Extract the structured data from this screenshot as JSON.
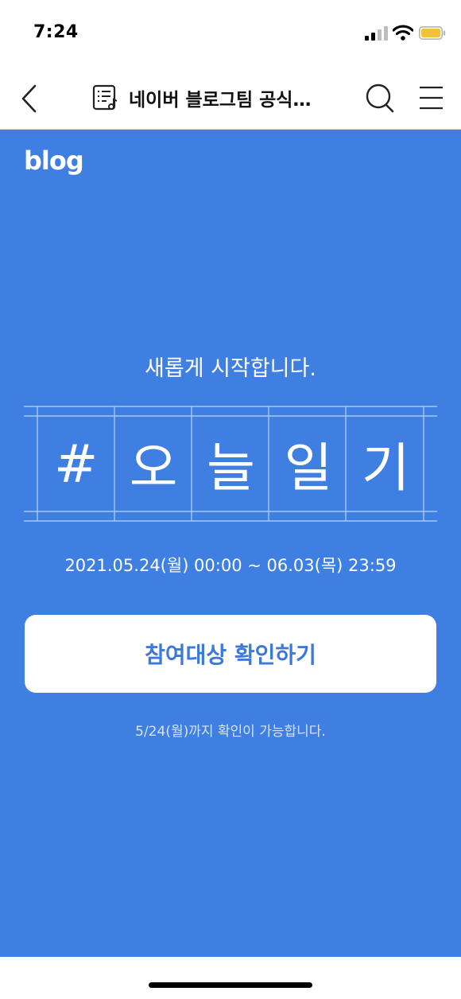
{
  "status_bar": {
    "time": "7:24"
  },
  "nav": {
    "title": "네이버 블로그팀 공식…",
    "icons": [
      "back-chevron-icon",
      "doc-list-icon",
      "search-icon",
      "menu-icon"
    ]
  },
  "banner": {
    "logo": "blog",
    "subtitle": "새롭게 시작합니다.",
    "hashtag_chars": [
      "#",
      "오",
      "늘",
      "일",
      "기"
    ],
    "date_range": "2021.05.24(월) 00:00 ~ 06.03(목) 23:59",
    "cta_label": "참여대상 확인하기",
    "note": "5/24(월)까지 확인이 가능합니다."
  },
  "colors": {
    "banner_bg": "#3f7fe1",
    "cta_text": "#3d79d8"
  }
}
